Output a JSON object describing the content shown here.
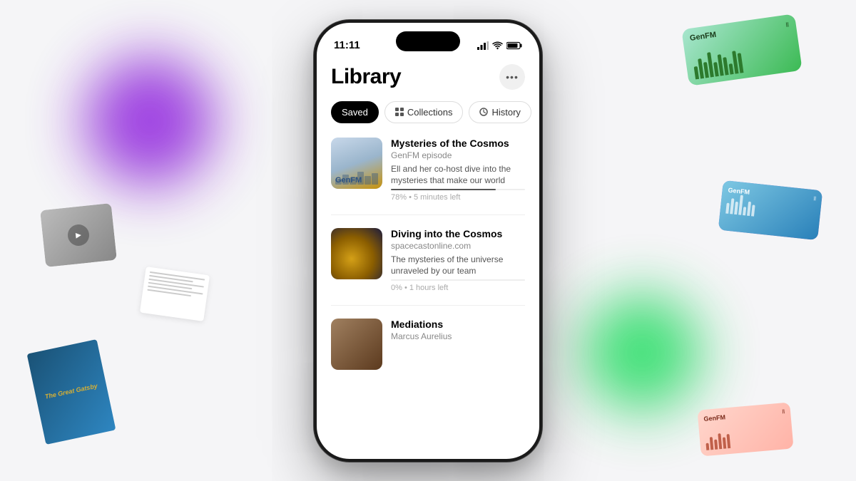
{
  "app": {
    "title": "Library",
    "status_time": "11:11"
  },
  "tabs": [
    {
      "id": "saved",
      "label": "Saved",
      "active": true,
      "icon": null
    },
    {
      "id": "collections",
      "label": "Collections",
      "active": false,
      "icon": "grid"
    },
    {
      "id": "history",
      "label": "History",
      "active": false,
      "icon": "clock"
    }
  ],
  "more_button_label": "•••",
  "library_items": [
    {
      "id": "item1",
      "title": "Mysteries of the Cosmos",
      "source": "GenFM episode",
      "description": "Ell and her co-host dive into the mysteries that make our world",
      "meta": "78% • 5 minutes left",
      "progress": 78,
      "thumb_type": "genfm"
    },
    {
      "id": "item2",
      "title": "Diving into the Cosmos",
      "source": "spacecastonline.com",
      "description": "The mysteries of the universe unraveled by our team",
      "meta": "0% • 1 hours left",
      "progress": 0,
      "thumb_type": "cosmos"
    },
    {
      "id": "item3",
      "title": "Mediations",
      "source": "Marcus Aurelius",
      "description": "",
      "meta": "",
      "progress": 0,
      "thumb_type": "mediations"
    }
  ],
  "floating_cards": {
    "genfm_green_label": "GenFM",
    "genfm_blue_label": "GenFM",
    "genfm_pink_label": "GenFM",
    "gatsby_title": "The Great Gatsby",
    "pause_char": "ll"
  },
  "bars_green": [
    18,
    28,
    22,
    35,
    20,
    30,
    25,
    15,
    32,
    28
  ],
  "bars_blue": [
    15,
    22,
    18,
    28,
    12,
    25,
    20,
    30
  ],
  "bars_pink": [
    10,
    18,
    14,
    22,
    16,
    20,
    12,
    25
  ]
}
